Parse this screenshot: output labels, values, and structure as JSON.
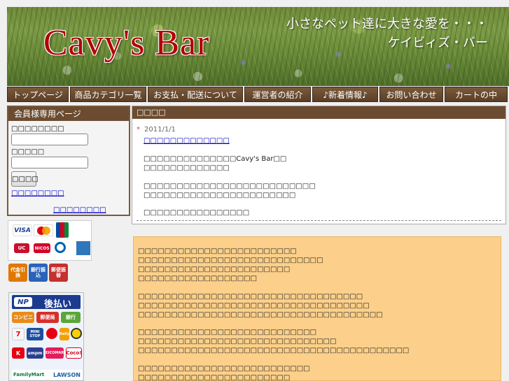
{
  "header": {
    "logo_text": "Cavy's Bar",
    "tagline_line1": "小さなペット達に大きな愛を・・・",
    "tagline_line2": "ケイビィズ・バー"
  },
  "nav": {
    "items": [
      {
        "label": "トップページ"
      },
      {
        "label": "商品カテゴリ一覧"
      },
      {
        "label": "お支払・配送について"
      },
      {
        "label": "運営者の紹介"
      },
      {
        "label": "♪新着情報♪"
      },
      {
        "label": "お問い合わせ"
      },
      {
        "label": "カートの中"
      }
    ]
  },
  "member_box": {
    "title": "会員様専用ページ",
    "id_label": "□□□□□□□□",
    "password_label": "□□□□□",
    "id_value": "",
    "password_value": "",
    "login_label": "□□□□",
    "forgot_link": "□□□□□□□□",
    "register_link": "□□□□□□□□"
  },
  "payment": {
    "card_brands": [
      "VISA",
      "MasterCard",
      "JCB",
      "UC",
      "NICOS",
      "Diners Club",
      "AMERICAN EXPRESS"
    ],
    "methods": [
      "代金引換",
      "銀行振込",
      "郵便振替"
    ],
    "deferred": {
      "brand": "NP",
      "label": "後払い",
      "options": [
        "コンビニ",
        "郵便局",
        "銀行"
      ],
      "stores": [
        "7",
        "MINI STOP",
        "K",
        "Daily",
        "D",
        "ampm",
        "SEICOMART",
        "Coco!"
      ],
      "store_footer": [
        "FamilyMart",
        "LAWSON"
      ]
    }
  },
  "notice": {
    "title": "□□□□",
    "date_mark": "*",
    "date": "2011/1/1",
    "headline_link": "□□□□□□□□□□□□□",
    "lines": [
      "□□□□□□□□□□□□□□Cavy's Bar□□",
      "□□□□□□□□□□□□□",
      "",
      "□□□□□□□□□□□□□□□□□□□□□□□□□□",
      "□□□□□□□□□□□□□□□□□□□□□□□",
      "",
      "□□□□□□□□□□□□□□□□"
    ]
  },
  "info": {
    "paragraphs": [
      [
        "□□□□□□□□□□□□□□□□□□□□□□□□",
        "□□□□□□□□□□□□□□□□□□□□□□□□□□□□",
        "□□□□□□□□□□□□□□□□□□□□□□□",
        "□□□□□□□□□□□□□□□□□□"
      ],
      [
        "□□□□□□□□□□□□□□□□□□□□□□□□□□□□□□□□□□",
        "□□□□□□□□□□□□□□□□□□□□□□□□□□□□□□□□□□□",
        "□□□□□□□□□□□□□□□□□□□□□□□□□□□□□□□□□□□□□"
      ],
      [
        "□□□□□□□□□□□□□□□□□□□□□□□□□□□",
        "□□□□□□□□□□□□□□□□□□□□□□□□□□□□□□",
        "□□□□□□□□□□□□□□□□□□□□□□□□□□□□□□□□□□□□□□□□□"
      ],
      [
        "□□□□□□□□□□□□□□□□□□□□□□□□□□",
        "□□□□□□□□□□□□□□□□□□□□□□□"
      ]
    ]
  },
  "colors": {
    "nav_brown": "#6b4c30",
    "logo_red": "#b00000",
    "info_bg": "#fcd08a",
    "link_blue": "#0000cc"
  }
}
